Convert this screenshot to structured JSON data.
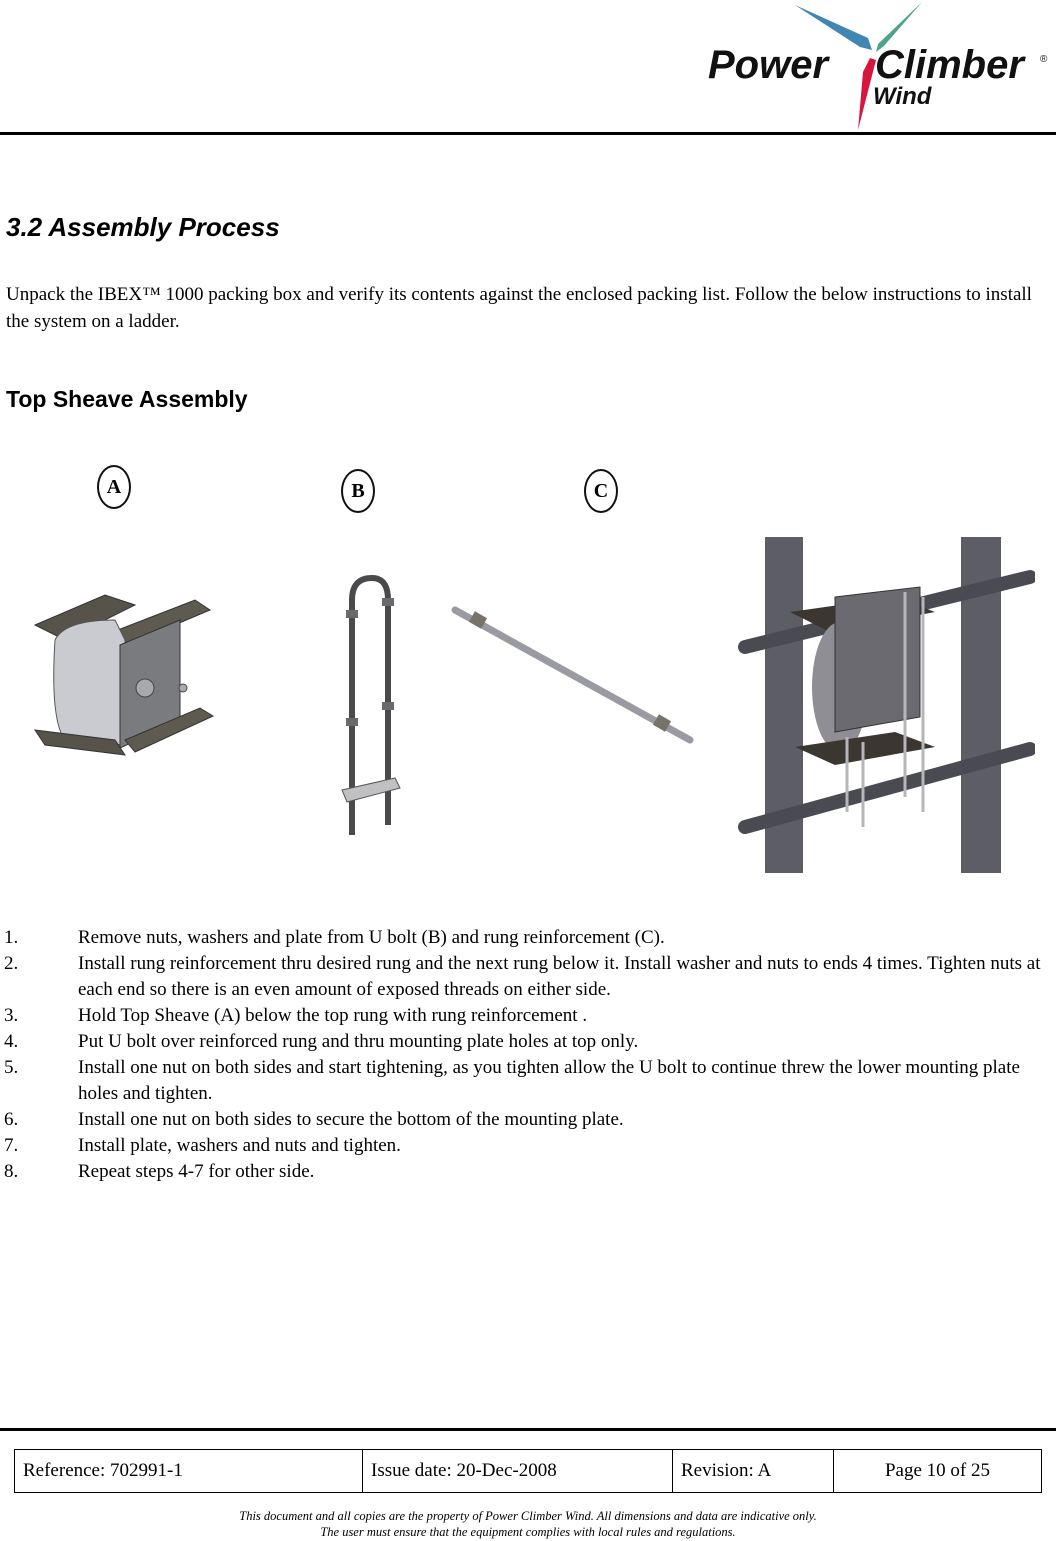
{
  "header": {
    "logo": {
      "word_left": "Power",
      "word_right": "Climber",
      "sub_word": "Wind",
      "registered_mark": "®",
      "colors": {
        "blade_left": "#3f86b3",
        "blade_right": "#4fa38c",
        "blade_bottom": "#d6163f",
        "text": "#111111"
      }
    }
  },
  "section": {
    "title": "3.2 Assembly Process",
    "intro": "Unpack the IBEX™ 1000 packing box and verify its contents against the enclosed packing list.  Follow the below instructions to install the system on a ladder."
  },
  "subsection": {
    "title": "Top Sheave Assembly",
    "callouts": [
      "A",
      "B",
      "C"
    ],
    "figures": [
      {
        "name": "Top Sheave",
        "label": "A"
      },
      {
        "name": "U bolt",
        "label": "B"
      },
      {
        "name": "Rung reinforcement",
        "label": "C"
      },
      {
        "name": "Assembled on ladder",
        "label": ""
      }
    ]
  },
  "steps": [
    {
      "num": "1.",
      "text": "Remove nuts, washers and plate from U bolt (B) and rung reinforcement (C)."
    },
    {
      "num": "2.",
      "text": "Install rung reinforcement thru desired rung and the next rung below it. Install washer and nuts to ends 4 times. Tighten nuts at each end so there is an even amount of exposed threads on either side."
    },
    {
      "num": "3.",
      "text": "Hold Top Sheave (A) below the top rung with rung reinforcement ."
    },
    {
      "num": "4.",
      "text": "Put U bolt over reinforced rung and thru mounting plate holes at top only."
    },
    {
      "num": "5.",
      "text": "Install one nut on both sides and start tightening, as you tighten allow the U bolt to continue threw the lower mounting plate holes and tighten."
    },
    {
      "num": "6.",
      "text": "Install one nut on both sides to secure the bottom of the mounting plate."
    },
    {
      "num": "7.",
      "text": "Install plate, washers and nuts and tighten."
    },
    {
      "num": "8.",
      "text": "Repeat steps 4-7 for other side."
    }
  ],
  "footer": {
    "reference": "Reference: 702991-1",
    "issue_date": "Issue date: 20-Dec-2008",
    "revision": "Revision: A",
    "page": "Page 10 of 25",
    "disclaimer_line1": "This document and all copies are the property of Power Climber Wind.  All dimensions and data are indicative only.",
    "disclaimer_line2": "The user must ensure that the equipment complies with local rules and regulations."
  }
}
